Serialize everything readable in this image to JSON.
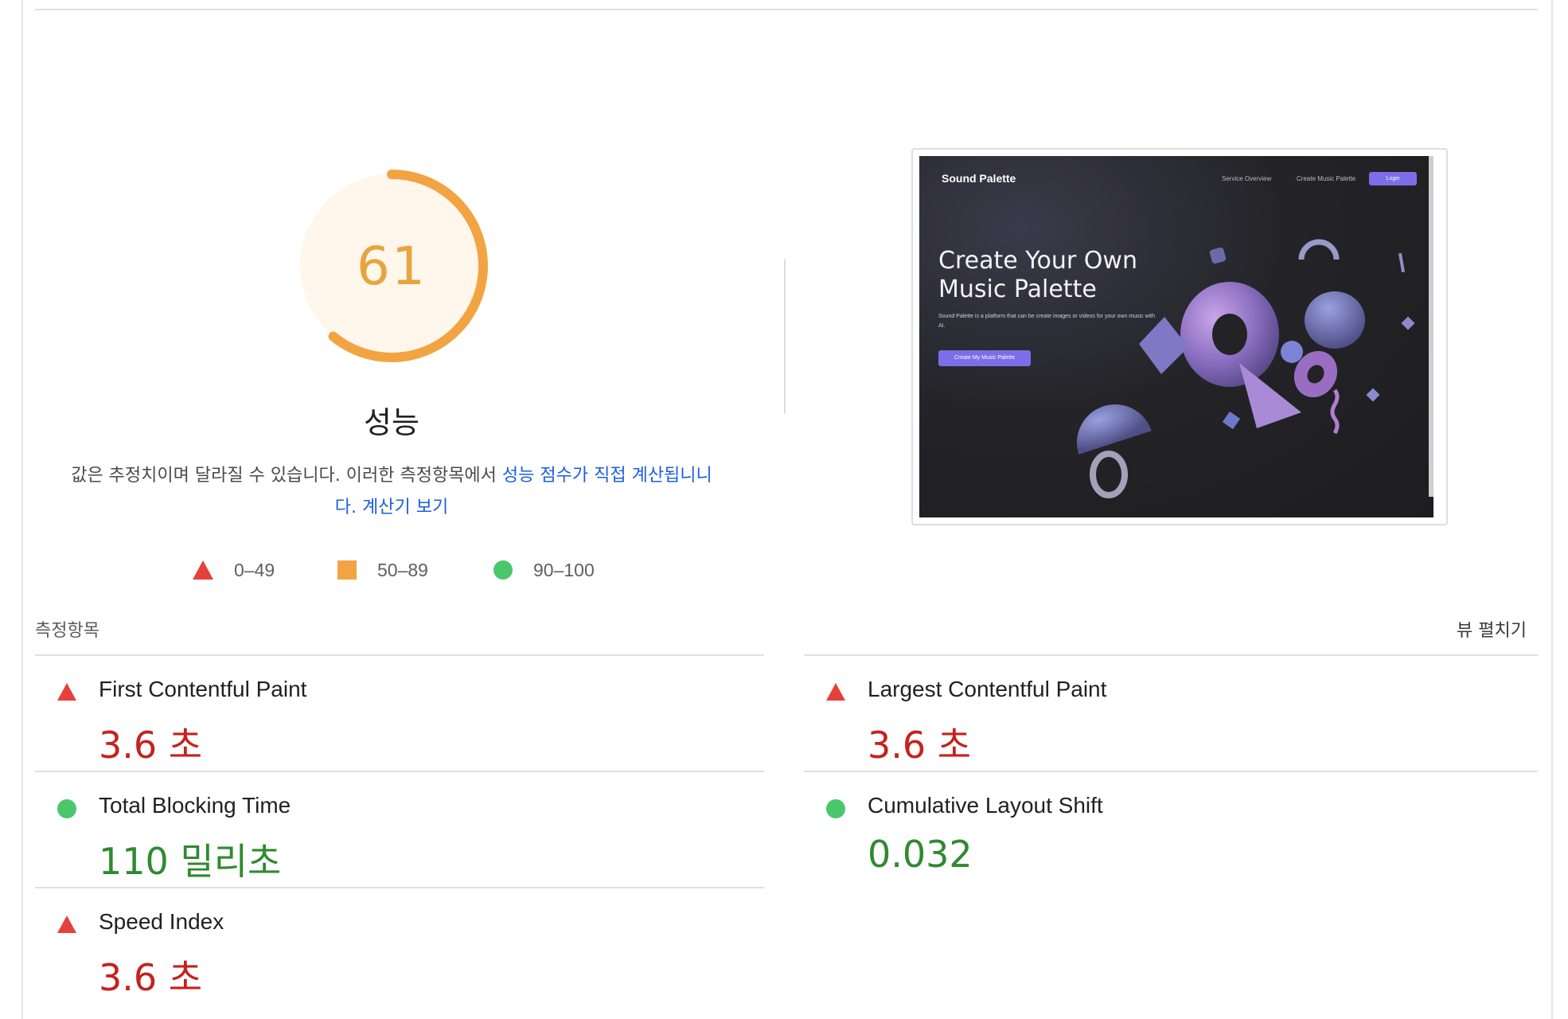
{
  "performance": {
    "score": "61",
    "score_fraction": 0.61,
    "title": "성능",
    "score_color": "#e8a43f",
    "ring_color": "#f2a443",
    "ring_bg": "#fff6ec"
  },
  "description": {
    "text_prefix": "값은 추정치이며 달라질 수 있습니다. 이러한 측정항목에서 ",
    "link1": "성능 점수가 직접 계산됩니다",
    "text_mid": ". ",
    "link2": "계산기 보기",
    "line1_plain": "값은 추정치이며 달라질 수 있습니다. 이러한 측정항목에서 ",
    "line1_link": "성능 점수가 직접 계산됩니니",
    "line2_link_a": "다.",
    "line2_link_b": "계산기 보기"
  },
  "legend": [
    {
      "shape": "triangle",
      "color": "#e5413b",
      "label": "0–49"
    },
    {
      "shape": "square",
      "color": "#f2a443",
      "label": "50–89"
    },
    {
      "shape": "circle",
      "color": "#4ac76b",
      "label": "90–100"
    }
  ],
  "screenshot": {
    "brand": "Sound Palette",
    "nav": [
      "Service Overview",
      "Create Music Palette"
    ],
    "login": "Login",
    "hero_line1": "Create Your Own",
    "hero_line2": "Music Palette",
    "subtitle": "Sound Palette is a platform that can be create images or videos for your own music with AI.",
    "cta": "Create My Music Palette"
  },
  "metrics_section": {
    "heading": "측정항목",
    "expand": "뷰 펼치기"
  },
  "metrics": [
    {
      "id": "fcp",
      "name": "First Contentful Paint",
      "value": "3.6 초",
      "status": "fail"
    },
    {
      "id": "lcp",
      "name": "Largest Contentful Paint",
      "value": "3.6 초",
      "status": "fail"
    },
    {
      "id": "tbt",
      "name": "Total Blocking Time",
      "value": "110 밀리초",
      "status": "pass"
    },
    {
      "id": "cls",
      "name": "Cumulative Layout Shift",
      "value": "0.032",
      "status": "pass"
    },
    {
      "id": "si",
      "name": "Speed Index",
      "value": "3.6 초",
      "status": "fail"
    }
  ]
}
